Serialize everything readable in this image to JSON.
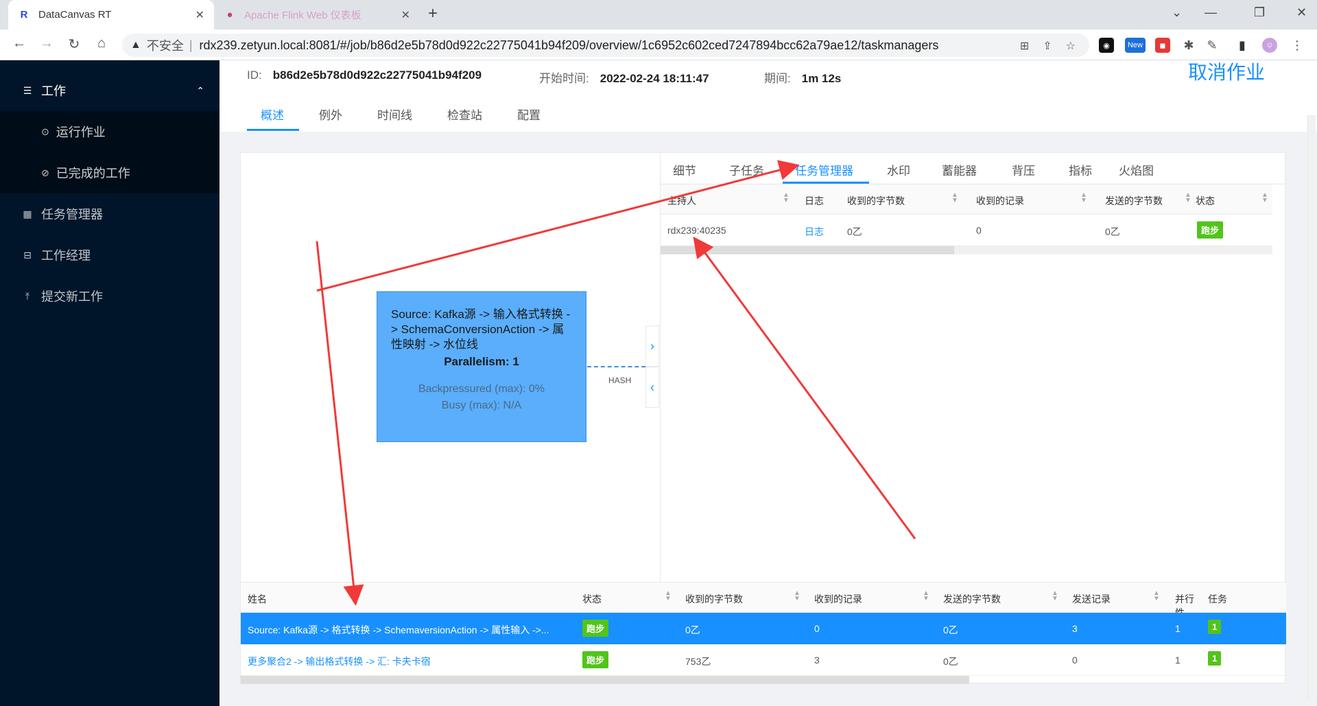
{
  "browser": {
    "tabs": [
      {
        "title": "DataCanvas RT",
        "active": true
      },
      {
        "title": "Apache Flink Web 仪表板",
        "active": false
      }
    ],
    "new_tab": "+",
    "address": {
      "warning": "▲",
      "insecure": "不安全",
      "separator": "|",
      "url": "rdx239.zetyun.local:8081/#/job/b86d2e5b78d0d922c22775041b94f209/overview/1c6952c602ced7247894bcc62a79ae12/taskmanagers"
    },
    "extension_new": "New"
  },
  "sidebar": {
    "section_title": "工作",
    "sub_items": [
      {
        "label": "运行作业"
      },
      {
        "label": "已完成的工作"
      }
    ],
    "items": [
      {
        "label": "任务管理器"
      },
      {
        "label": "工作经理"
      },
      {
        "label": "提交新工作"
      }
    ]
  },
  "job": {
    "id_label": "ID:",
    "id_value": "b86d2e5b78d0d922c22775041b94f209",
    "start_label": "开始时间:",
    "start_value": "2022-02-24 18:11:47",
    "duration_label": "期间:",
    "duration_value": "1m 12s",
    "cancel_label": "取消作业"
  },
  "main_tabs": [
    "概述",
    "例外",
    "时间线",
    "检查站",
    "配置"
  ],
  "graph": {
    "node_title": "Source: Kafka源 -> 输入格式转换 -> SchemaConversionAction -> 属性映射 -> 水位线",
    "parallelism": "Parallelism: 1",
    "backpressured": "Backpressured (max): 0%",
    "busy": "Busy (max): N/A",
    "edge_label": "HASH"
  },
  "detail": {
    "tabs": [
      "细节",
      "子任务",
      "任务管理器",
      "水印",
      "蓄能器",
      "背压",
      "指标",
      "火焰图"
    ],
    "headers": [
      "主持人",
      "日志",
      "收到的字节数",
      "收到的记录",
      "发送的字节数",
      "状态"
    ],
    "row": {
      "host": "rdx239:40235",
      "log": "日志",
      "bytes_received": "0乙",
      "records_received": "0",
      "bytes_sent": "0乙",
      "status": "跑步"
    }
  },
  "vertices": {
    "headers": [
      "姓名",
      "状态",
      "收到的字节数",
      "收到的记录",
      "发送的字节数",
      "发送记录",
      "并行性",
      "任务"
    ],
    "rows": [
      {
        "name": "Source: Kafka源 -> 格式转换 -> SchemaversionAction -> 属性输入 ->...",
        "status": "跑步",
        "bytes_received": "0乙",
        "records_received": "0",
        "bytes_sent": "0乙",
        "records_sent": "3",
        "parallelism": "1",
        "tasks": "1"
      },
      {
        "name": "更多聚合2 -> 输出格式转换 -> 汇: 卡夫卡宿",
        "status": "跑步",
        "bytes_received": "753乙",
        "records_received": "3",
        "bytes_sent": "0乙",
        "records_sent": "0",
        "parallelism": "1",
        "tasks": "1"
      }
    ]
  },
  "colors": {
    "accent": "#1890ff",
    "sidebar_bg": "#001529",
    "running": "#52c41a",
    "node_fill": "#5aaefc",
    "annotation": "#f03a3a"
  }
}
